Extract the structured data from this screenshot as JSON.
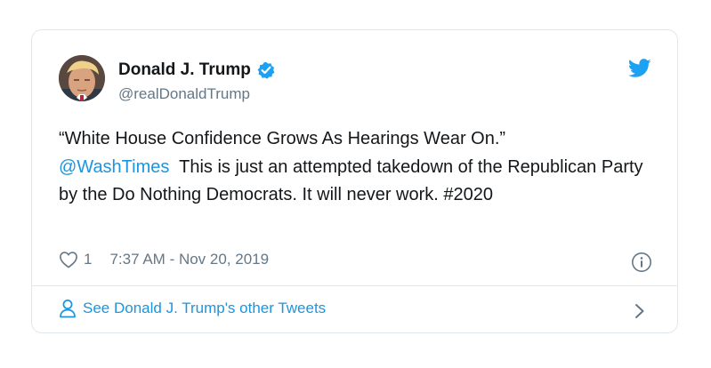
{
  "author": {
    "name": "Donald J. Trump",
    "handle": "@realDonaldTrump",
    "verified": true
  },
  "icons": {
    "avatar": "profile-photo",
    "verified": "verified-badge-icon",
    "brand": "twitter-bird-icon",
    "like": "heart-icon",
    "info": "info-icon",
    "profile": "person-icon",
    "more": "chevron-right-icon"
  },
  "tweet": {
    "quote": "“White House Confidence Grows As Hearings Wear On.”",
    "mention": "@WashTimes",
    "body": "  This is just an attempted takedown of the Republican Party by the Do Nothing Democrats. It will never work. ",
    "hashtag": "#2020"
  },
  "meta": {
    "like_count": "1",
    "timestamp": "7:37 AM - Nov 20, 2019"
  },
  "footer": {
    "label": "See Donald J. Trump's other Tweets"
  },
  "colors": {
    "link": "#1b95e0",
    "verified": "#1da1f2",
    "muted": "#657786",
    "border": "#e1e8ed"
  }
}
